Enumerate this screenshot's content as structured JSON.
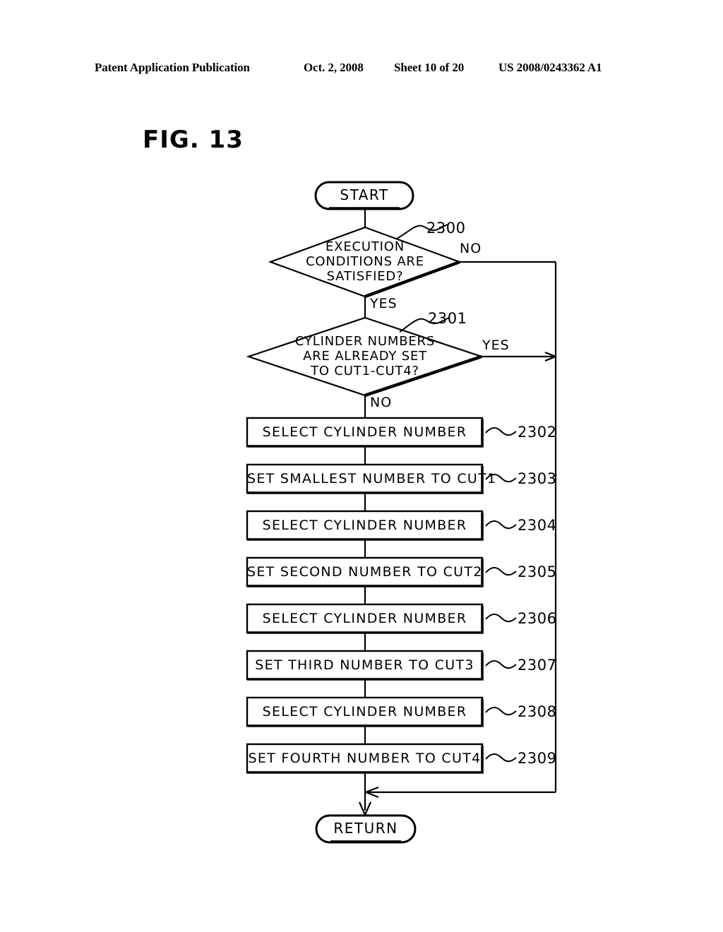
{
  "header": {
    "publication": "Patent Application Publication",
    "date": "Oct. 2, 2008",
    "sheet": "Sheet 10 of 20",
    "patent_number": "US 2008/0243362 A1"
  },
  "figure": {
    "title": "FIG. 13"
  },
  "flowchart": {
    "start": {
      "label": "START"
    },
    "end": {
      "label": "RETURN"
    },
    "decisions": [
      {
        "id": "2300",
        "ref": "2300",
        "text": "EXECUTION\nCONDITIONS ARE\nSATISFIED?",
        "yes_label": "YES",
        "no_label": "NO"
      },
      {
        "id": "2301",
        "ref": "2301",
        "text": "CYLINDER NUMBERS\nARE ALREADY SET\nTO CUT1-CUT4?",
        "yes_label": "YES",
        "no_label": "NO"
      }
    ],
    "steps": [
      {
        "ref": "2302",
        "text": "SELECT CYLINDER NUMBER"
      },
      {
        "ref": "2303",
        "text": "SET SMALLEST NUMBER TO CUT1"
      },
      {
        "ref": "2304",
        "text": "SELECT CYLINDER NUMBER"
      },
      {
        "ref": "2305",
        "text": "SET SECOND NUMBER TO CUT2"
      },
      {
        "ref": "2306",
        "text": "SELECT CYLINDER NUMBER"
      },
      {
        "ref": "2307",
        "text": "SET THIRD NUMBER TO CUT3"
      },
      {
        "ref": "2308",
        "text": "SELECT CYLINDER NUMBER"
      },
      {
        "ref": "2309",
        "text": "SET FOURTH NUMBER TO CUT4"
      }
    ]
  },
  "colors": {
    "ink": "#000000",
    "paper": "#ffffff"
  }
}
